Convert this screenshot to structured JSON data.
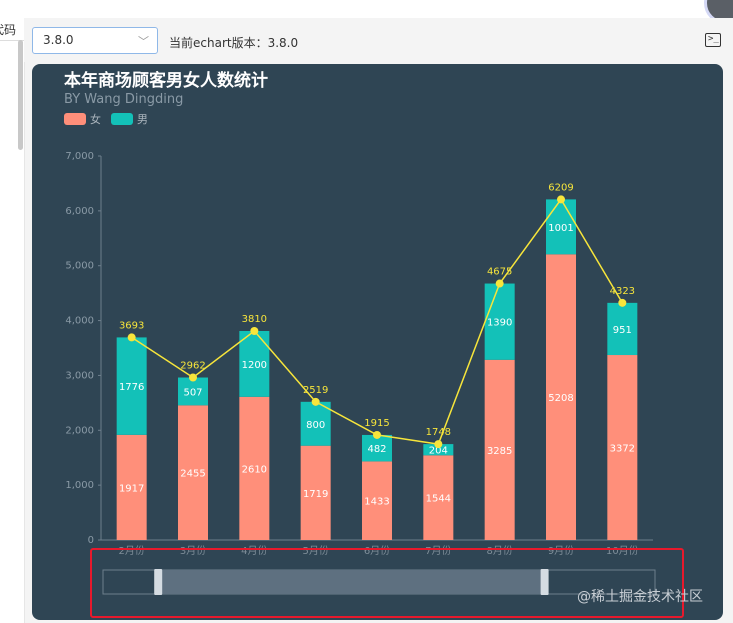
{
  "sidebar": {
    "code_label": "代码"
  },
  "toolbar": {
    "version_select_value": "3.8.0",
    "version_text": "当前echart版本：3.8.0"
  },
  "icons": {
    "terminal": "terminal-icon",
    "dropdown": "chevron-down-icon"
  },
  "watermark": "@稀土掘金技术社区",
  "colors": {
    "background": "#2f4554",
    "female": "#ff8f7a",
    "male": "#13c1b8",
    "total_line": "#f7e53b"
  },
  "chart_data": {
    "type": "bar",
    "title": "本年商场顾客男女人数统计",
    "subtitle": "BY Wang Dingding",
    "categories": [
      "2月份",
      "3月份",
      "4月份",
      "5月份",
      "6月份",
      "7月份",
      "8月份",
      "9月份",
      "10月份"
    ],
    "series": [
      {
        "name": "女",
        "stack": "total",
        "values": [
          1917,
          2455,
          2610,
          1719,
          1433,
          1544,
          3285,
          5208,
          3372
        ]
      },
      {
        "name": "男",
        "stack": "total",
        "values": [
          1776,
          507,
          1200,
          800,
          482,
          204,
          1390,
          1001,
          951
        ]
      }
    ],
    "totals": [
      3693,
      2962,
      3810,
      2519,
      1915,
      1748,
      4675,
      6209,
      4323
    ],
    "y_ticks": [
      "0",
      "1,000",
      "2,000",
      "3,000",
      "4,000",
      "5,000",
      "6,000",
      "7,000"
    ],
    "ylim": [
      0,
      7000
    ],
    "legend_position": "top-left",
    "grid": false,
    "datazoom": {
      "start": 0.1,
      "end": 0.8
    }
  }
}
